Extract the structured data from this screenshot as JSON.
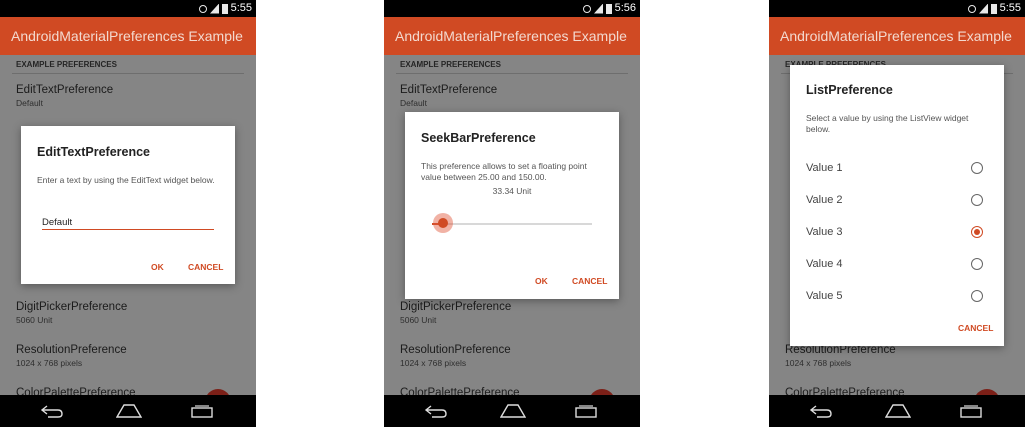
{
  "screens": [
    {
      "time": "5:55",
      "app_title": "AndroidMaterialPreferences Example",
      "section_header": "EXAMPLE PREFERENCES",
      "prefs_top": [
        {
          "title": "EditTextPreference",
          "summary": "Default"
        }
      ],
      "prefs_bottom": [
        {
          "title": "DigitPickerPreference",
          "summary": "5060 Unit"
        },
        {
          "title": "ResolutionPreference",
          "summary": "1024 x 768 pixels"
        },
        {
          "title": "ColorPalettePreference",
          "summary": ""
        }
      ],
      "dialog": {
        "title": "EditTextPreference",
        "message": "Enter a text by using the EditText widget below.",
        "input_value": "Default",
        "ok": "OK",
        "cancel": "CANCEL"
      }
    },
    {
      "time": "5:56",
      "app_title": "AndroidMaterialPreferences Example",
      "section_header": "EXAMPLE PREFERENCES",
      "prefs_top": [
        {
          "title": "EditTextPreference",
          "summary": "Default"
        }
      ],
      "prefs_bottom": [
        {
          "title": "DigitPickerPreference",
          "summary": "5060 Unit"
        },
        {
          "title": "ResolutionPreference",
          "summary": "1024 x 768 pixels"
        },
        {
          "title": "ColorPalettePreference",
          "summary": ""
        }
      ],
      "dialog": {
        "title": "SeekBarPreference",
        "message": "This preference allows to set a floating point value between 25.00 and 150.00.",
        "value_text": "33.34 Unit",
        "seek_fraction": 0.067,
        "ok": "OK",
        "cancel": "CANCEL"
      }
    },
    {
      "time": "5:55",
      "app_title": "AndroidMaterialPreferences Example",
      "section_header": "EXAMPLE PREFERENCES",
      "prefs_top": [],
      "prefs_bottom": [
        {
          "title": "ResolutionPreference",
          "summary": "1024 x 768 pixels"
        },
        {
          "title": "ColorPalettePreference",
          "summary": ""
        }
      ],
      "dialog": {
        "title": "ListPreference",
        "message": "Select a value by using the ListView widget below.",
        "options": [
          "Value 1",
          "Value 2",
          "Value 3",
          "Value 4",
          "Value 5"
        ],
        "selected_index": 2,
        "cancel": "CANCEL"
      }
    }
  ],
  "colors": {
    "accent": "#d04a23",
    "app_bar": "#d04a23",
    "fab": "#e03a2a"
  }
}
